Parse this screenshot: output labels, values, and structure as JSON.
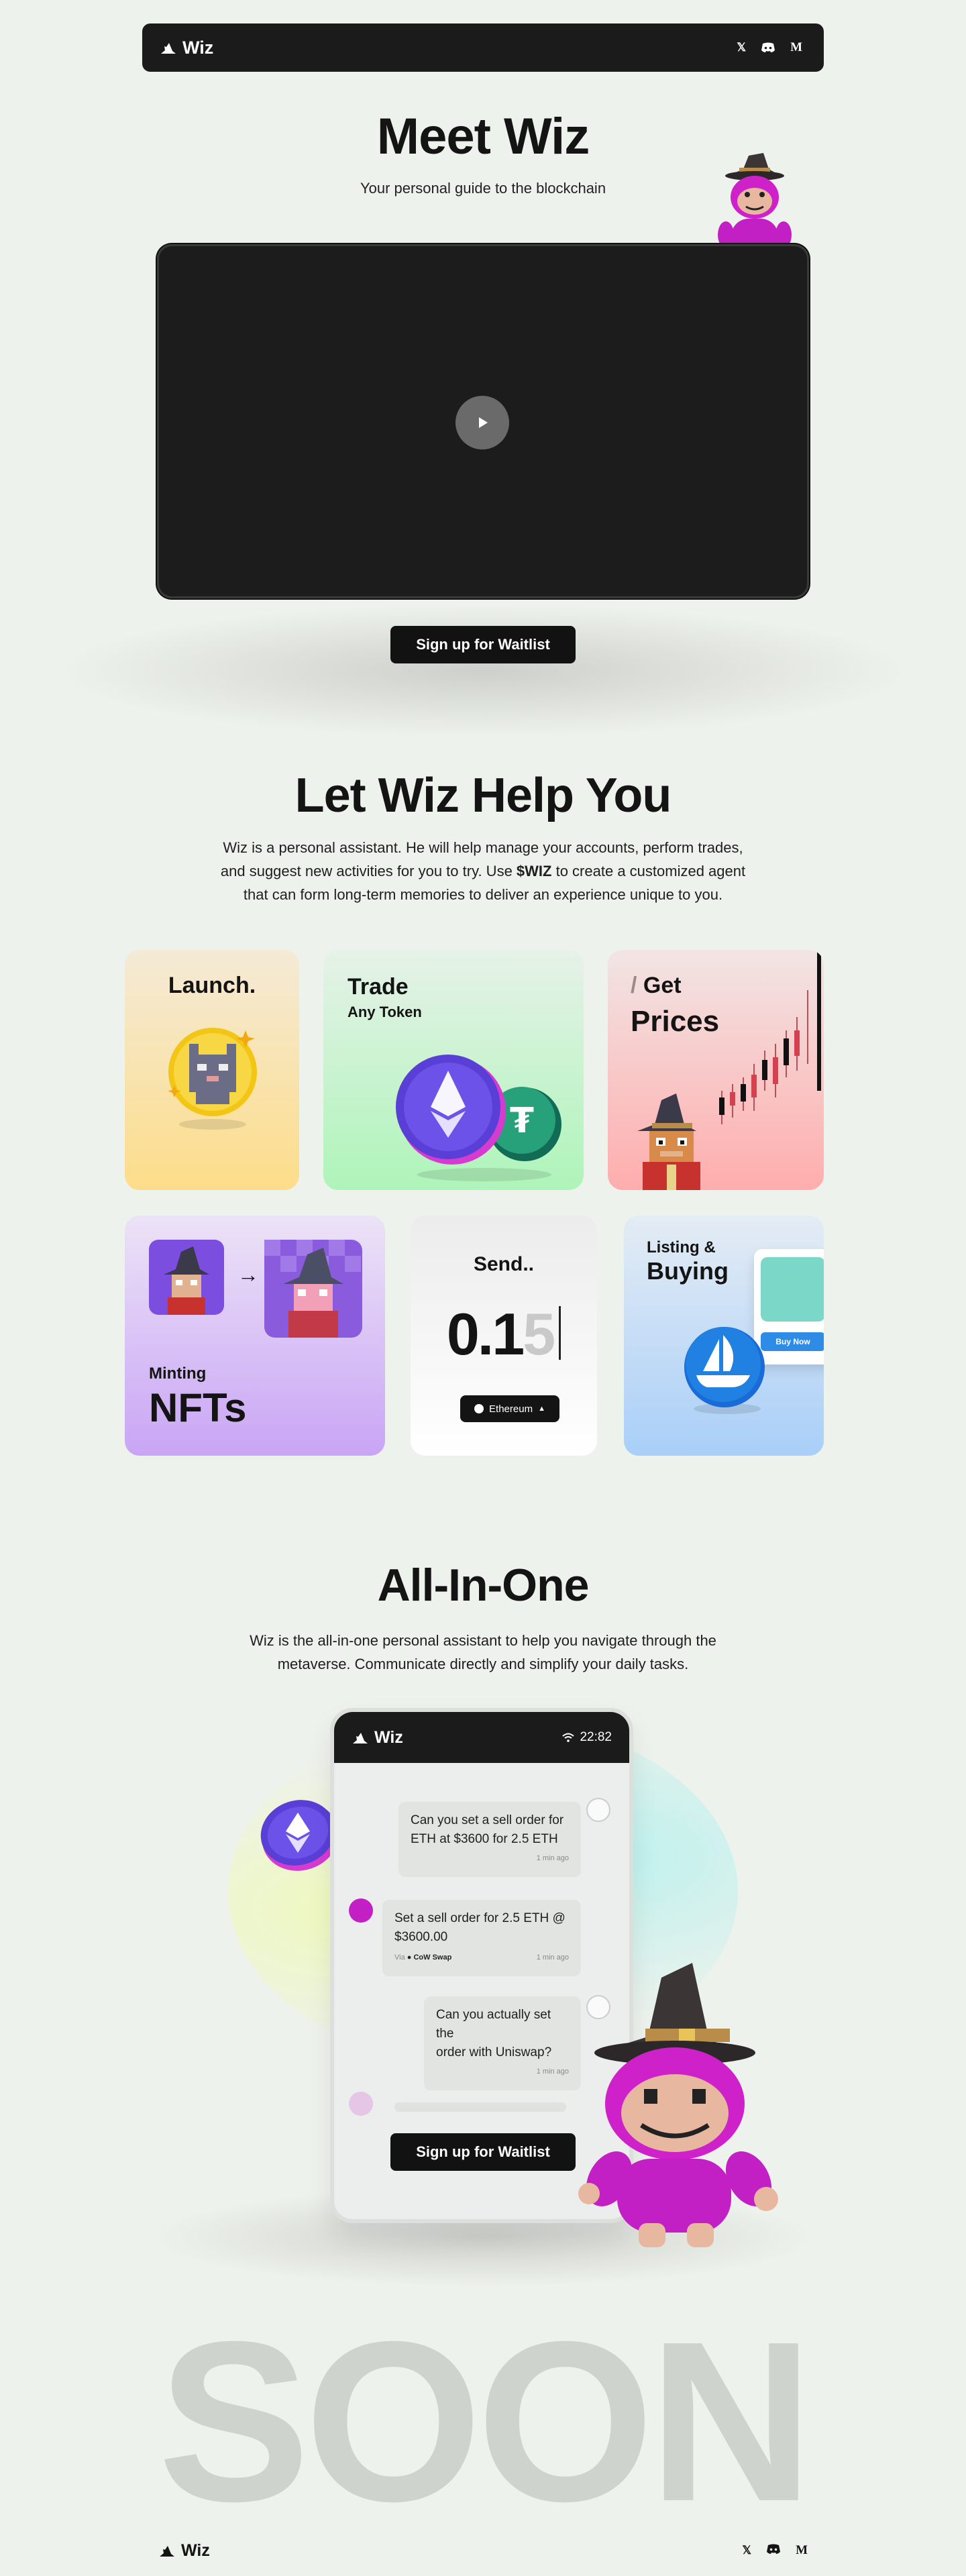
{
  "nav": {
    "brand": "Wiz",
    "icons": [
      "x-icon",
      "discord-icon",
      "medium-icon"
    ],
    "medium_label": "M",
    "x_label": "𝕏"
  },
  "hero": {
    "title": "Meet Wiz",
    "subtitle": "Your personal guide to the blockchain",
    "cta": "Sign up for Waitlist"
  },
  "help": {
    "title": "Let Wiz Help You",
    "body_1": "Wiz is a personal assistant. He will help manage your accounts, perform trades,",
    "body_2a": "and suggest new activities for you to try. Use ",
    "body_2b": "$WIZ",
    "body_2c": " to create a customized agent",
    "body_3": "that can form long-term memories to deliver an experience unique to you."
  },
  "cards": {
    "launch": {
      "title": "Launch."
    },
    "trade": {
      "title": "Trade",
      "subtitle": "Any Token"
    },
    "prices": {
      "slash": "/",
      "title_1": "Get",
      "title_2": "Prices"
    },
    "nfts": {
      "subtitle": "Minting",
      "title": "NFTs",
      "arrow": "→"
    },
    "send": {
      "title": "Send..",
      "amount_main": "0.1",
      "amount_ghost": "5",
      "network": "Ethereum"
    },
    "listing": {
      "subtitle": "Listing &",
      "title": "Buying",
      "buy_label": "Buy Now"
    }
  },
  "allinone": {
    "title": "All-In-One",
    "body_1": "Wiz is the all-in-one personal assistant to help you navigate through the",
    "body_2": "metaverse. Communicate directly and simplify your daily tasks.",
    "cta": "Sign up for Waitlist"
  },
  "phone": {
    "brand": "Wiz",
    "time": "22:82",
    "messages": [
      {
        "from": "user",
        "text_1": "Can you set a sell order for",
        "text_2": "ETH at $3600 for 2.5 ETH",
        "time": "1 min ago"
      },
      {
        "from": "wiz",
        "text_1": "Set a sell order for 2.5 ETH @",
        "text_2": "$3600.00",
        "via": "Via",
        "via_name": "CoW Swap",
        "time": "1 min ago"
      },
      {
        "from": "user",
        "text_1": "Can you actually set the",
        "text_2": "order with Uniswap?",
        "time": "1 min ago"
      }
    ]
  },
  "soon": "SOON",
  "footer": {
    "brand": "Wiz",
    "medium_label": "M",
    "x_label": "𝕏"
  },
  "colors": {
    "brand_dark": "#1b1b1b",
    "accent_purple": "#6b4de6",
    "accent_magenta": "#c21fc4"
  }
}
